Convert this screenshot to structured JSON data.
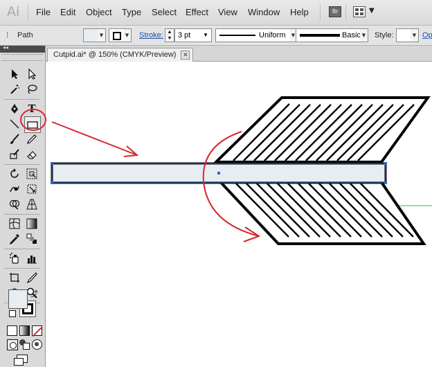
{
  "app": {
    "logo": "Ai"
  },
  "menu": [
    "File",
    "Edit",
    "Object",
    "Type",
    "Select",
    "Effect",
    "View",
    "Window",
    "Help"
  ],
  "bridge_label": "Br",
  "control_bar": {
    "selection_type": "Path",
    "fill_color": "#e8edf2",
    "stroke_label": "Stroke:",
    "stroke_weight": "3 pt",
    "profile": "Uniform",
    "brush": "Basic",
    "style_label": "Style:",
    "opacity_link": "Op"
  },
  "document_tab": {
    "title": "Cutpid.ai* @ 150% (CMYK/Preview)",
    "close_glyph": "✕"
  },
  "tools_panel": {
    "collapse_glyph": "◂◂"
  },
  "colors": {
    "accent_blue": "#3366cc",
    "annotation_red": "#d8262e",
    "guide_green": "#3cb44b",
    "arrow_shaft_fill": "#e8edf2"
  }
}
